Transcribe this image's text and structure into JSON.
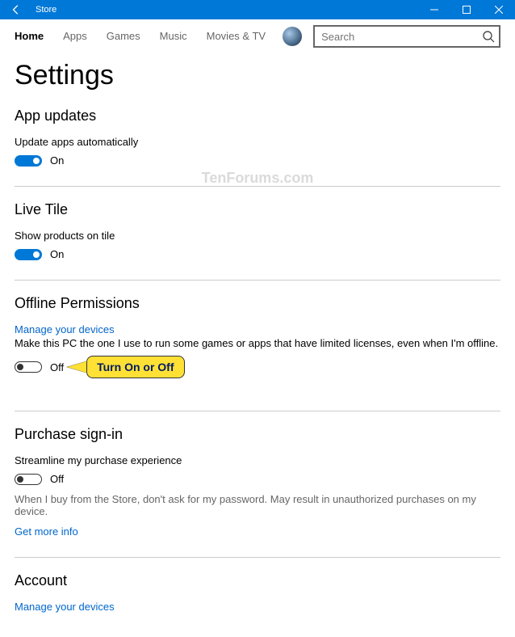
{
  "app": {
    "title": "Store"
  },
  "nav": {
    "tabs": [
      "Home",
      "Apps",
      "Games",
      "Music",
      "Movies & TV"
    ],
    "active": 0
  },
  "search": {
    "placeholder": "Search"
  },
  "page": {
    "title": "Settings"
  },
  "sections": {
    "app_updates": {
      "title": "App updates",
      "label": "Update apps automatically",
      "state": "On",
      "on": true
    },
    "live_tile": {
      "title": "Live Tile",
      "label": "Show products on tile",
      "state": "On",
      "on": true
    },
    "offline": {
      "title": "Offline Permissions",
      "link": "Manage your devices",
      "desc": "Make this PC the one I use to run some games or apps that have limited licenses, even when I'm offline.",
      "state": "Off",
      "on": false,
      "callout": "Turn On or Off"
    },
    "purchase": {
      "title": "Purchase sign-in",
      "label": "Streamline my purchase experience",
      "state": "Off",
      "on": false,
      "help": "When I buy from the Store, don't ask for my password. May result in unauthorized purchases on my device.",
      "more": "Get more info"
    },
    "account": {
      "title": "Account",
      "link": "Manage your devices"
    }
  },
  "watermark": "TenForums.com"
}
